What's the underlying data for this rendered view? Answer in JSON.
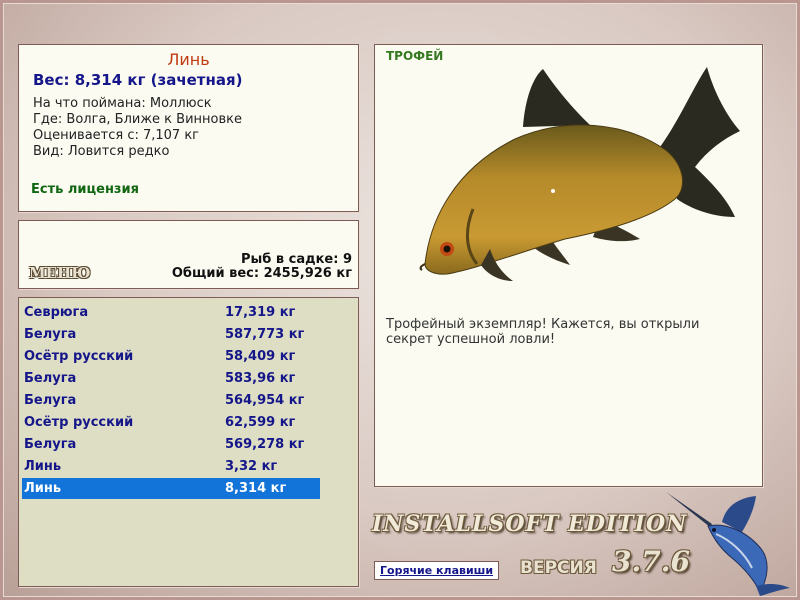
{
  "fish_info": {
    "name": "Линь",
    "weight": "Вес: 8,314 кг (зачетная)",
    "caught_on": "На что поймана: Моллюск",
    "where": "Где: Волга, Ближе к Винновке",
    "rated_from": "Оценивается с: 7,107 кг",
    "kind": "Вид: Ловится редко",
    "license": "Есть лицензия"
  },
  "menu": {
    "menu_label": "МЕНЮ",
    "keep_count": "Рыб в садке: 9",
    "keep_total_weight": "Общий вес: 2455,926 кг"
  },
  "catch_list": [
    {
      "name": "Севрюга",
      "weight": "17,319 кг"
    },
    {
      "name": "Белуга",
      "weight": "587,773 кг"
    },
    {
      "name": "Осётр русский",
      "weight": "58,409 кг"
    },
    {
      "name": "Белуга",
      "weight": "583,96 кг"
    },
    {
      "name": "Белуга",
      "weight": "564,954 кг"
    },
    {
      "name": "Осётр русский",
      "weight": "62,599 кг"
    },
    {
      "name": "Белуга",
      "weight": "569,278 кг"
    },
    {
      "name": "Линь",
      "weight": "3,32 кг"
    },
    {
      "name": "Линь",
      "weight": "8,314 кг"
    }
  ],
  "selected_index": 8,
  "trophy": {
    "title": "ТРОФЕЙ",
    "description": "Трофейный экземпляр! Кажется, вы открыли секрет успешной ловли!"
  },
  "footer": {
    "edition": "INSTALLSOFT EDITION",
    "version_label": "ВЕРСИЯ",
    "version_number": "3.7.6",
    "hotkeys_button": "Горячие клавиши"
  },
  "colors": {
    "selection": "#1273d8",
    "list_text": "#14168a",
    "fish_name": "#c03a10",
    "license_text": "#116611",
    "trophy_title": "#357a20"
  },
  "icons": {
    "fish_image": "tench-fish-icon",
    "logo": "marlin-logo-icon"
  }
}
